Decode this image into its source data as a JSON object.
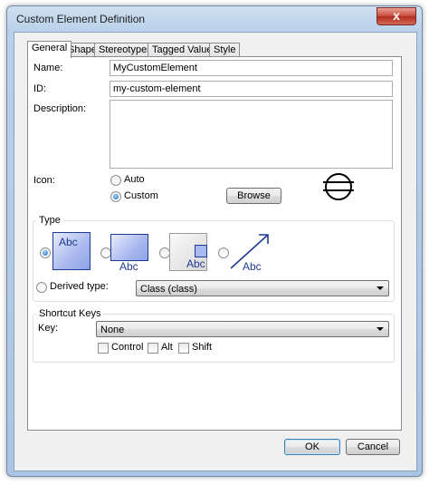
{
  "window": {
    "title": "Custom Element Definition",
    "close_glyph": "x"
  },
  "tabs": [
    {
      "label": "General",
      "active": true
    },
    {
      "label": "Shape",
      "active": false
    },
    {
      "label": "Stereotypes",
      "active": false
    },
    {
      "label": "Tagged Values",
      "active": false
    },
    {
      "label": "Style",
      "active": false
    }
  ],
  "general": {
    "name_label": "Name:",
    "name_value": "MyCustomElement",
    "id_label": "ID:",
    "id_value": "my-custom-element",
    "description_label": "Description:",
    "description_value": "",
    "icon_label": "Icon:",
    "icon_auto_label": "Auto",
    "icon_custom_label": "Custom",
    "icon_selected": "Custom",
    "browse_label": "Browse",
    "icon_preview": "circle-bar-icon"
  },
  "type_group": {
    "title": "Type",
    "options": [
      {
        "name": "class-box",
        "text": "Abc",
        "selected": true
      },
      {
        "name": "box-label-below",
        "text": "Abc",
        "selected": false
      },
      {
        "name": "box-with-port",
        "text": "Abc",
        "selected": false
      },
      {
        "name": "arrow-connector",
        "text": "Abc",
        "selected": false
      }
    ],
    "derived_label": "Derived type:",
    "derived_value": "Class (class)",
    "accent_color": "#1f3a93"
  },
  "shortcut_group": {
    "title": "Shortcut Keys",
    "key_label": "Key:",
    "key_value": "None",
    "control_label": "Control",
    "alt_label": "Alt",
    "shift_label": "Shift"
  },
  "footer": {
    "ok_label": "OK",
    "cancel_label": "Cancel"
  }
}
